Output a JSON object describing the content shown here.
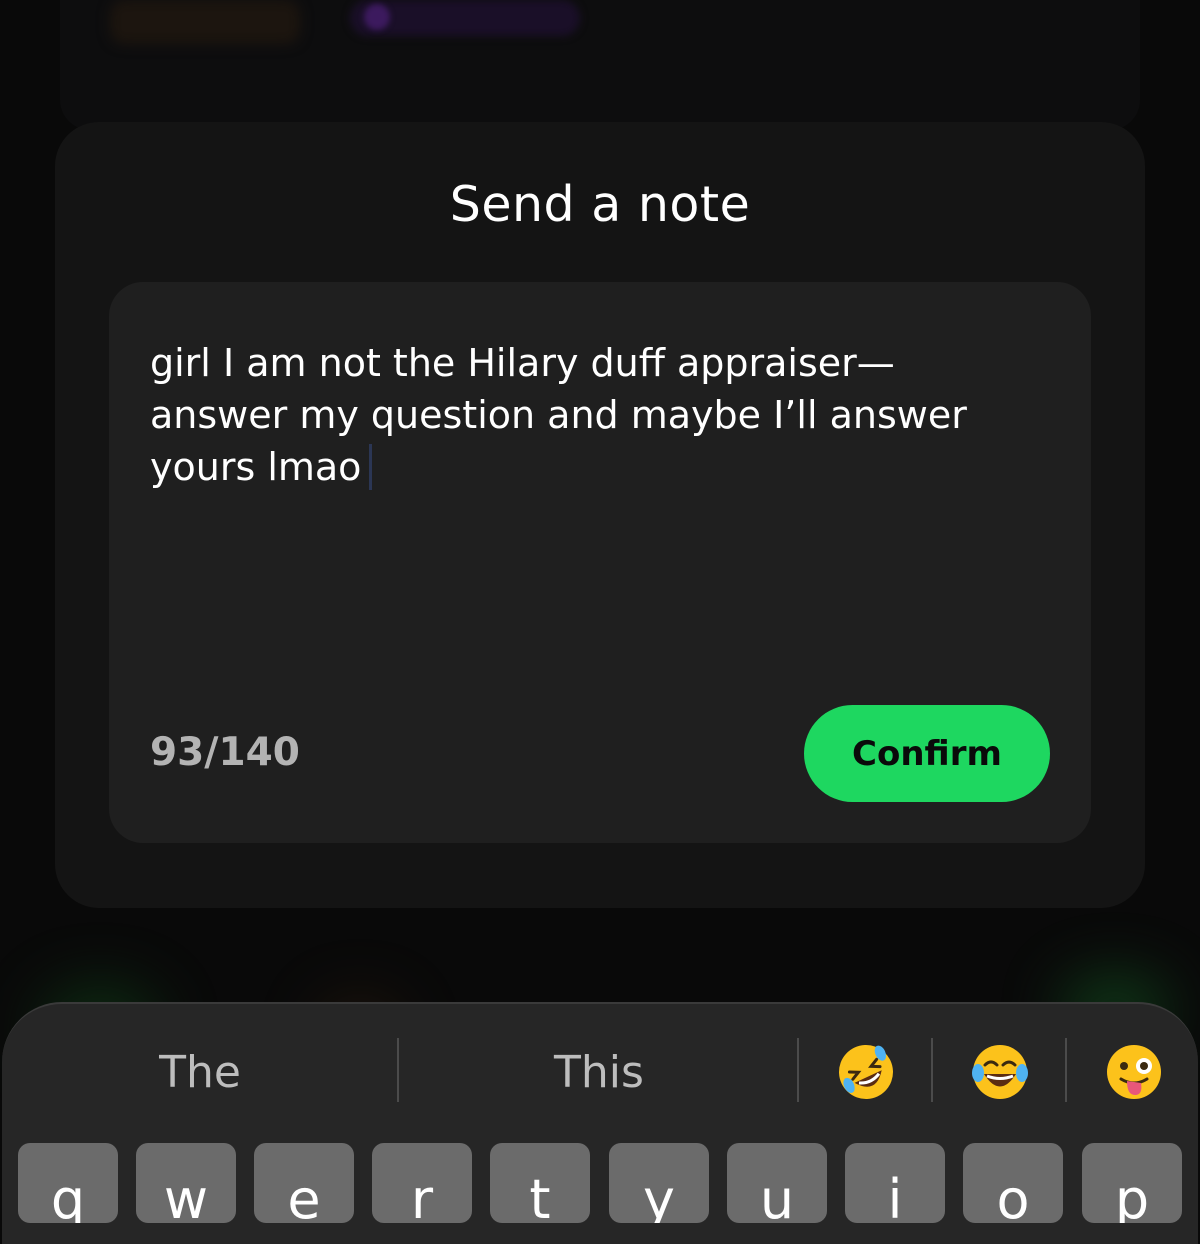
{
  "modal": {
    "title": "Send a note",
    "note_text": "girl I am not the Hilary duff appraiser—\nanswer my question and maybe I’ll answer\nyours lmao",
    "char_count": "93/140",
    "char_used": 93,
    "char_limit": 140,
    "confirm_label": "Confirm"
  },
  "keyboard": {
    "suggestions": [
      "The",
      "This"
    ],
    "emoji_suggestions": [
      "rolling-on-floor-laughing",
      "tears-of-joy",
      "winking-face-with-tongue"
    ],
    "keys_row1": [
      "q",
      "w",
      "e",
      "r",
      "t",
      "y",
      "u",
      "i",
      "o",
      "p"
    ]
  },
  "colors": {
    "accent": "#1ed760",
    "background": "#090909",
    "modal": "#141414",
    "input_box": "#1f1f1f",
    "counter_text": "#b3b3b3"
  }
}
